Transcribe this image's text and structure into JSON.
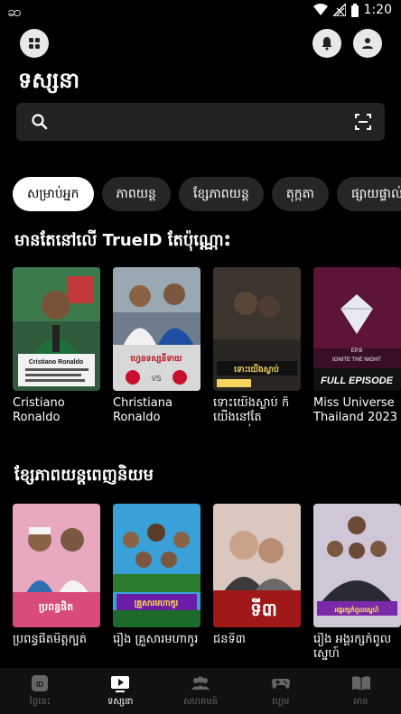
{
  "status": {
    "time": "1:20"
  },
  "header": {
    "title": "ទស្សនា"
  },
  "search": {
    "placeholder": ""
  },
  "chips": [
    "សម្រាប់អ្នក",
    "ភាពយន្ត",
    "ខ្សែភាពយន្ត",
    "តុក្កតា",
    "ផ្សាយផ្ទាល់"
  ],
  "section1": {
    "title": "មានតែនៅលើ TrueID តែប៉ុណ្ណោះ",
    "cards": [
      {
        "title": "Cristiano Ronaldo",
        "thumb_text": "Cristiano Ronaldo"
      },
      {
        "title": "Christiana Ronaldo",
        "thumb_text": "ហ្វេនទស្សនីទាយ"
      },
      {
        "title": "ទោះយើងស្លាប់ ក៏យើងនៅតែស្រឡាញ់",
        "thumb_text": "ទោះយើងស្លាប់"
      },
      {
        "title": "Miss Universe Thailand 2023",
        "thumb_text": "FULL EPISODE",
        "thumb_sub": "IGNITE THE NIGHT",
        "thumb_ep": "EP.8"
      }
    ]
  },
  "section2": {
    "title": "ខ្សែភាពយន្តពេញនិយម",
    "cards": [
      {
        "title": "ប្រពន្ធផិតមិត្តក្បត់",
        "thumb_text": "ប្រពន្ធផិត"
      },
      {
        "title": "រឿង គ្រួសារមហាកូរ",
        "thumb_text": "គ្រួសារមហាកូរ"
      },
      {
        "title": "ជនទី៣",
        "thumb_text": "ទី៣"
      },
      {
        "title": "រឿង អង្គរក្សកំពូលស្នេហ៍",
        "thumb_text": "អង្គរក្សកំពូលស្នេហ៍"
      }
    ]
  },
  "nav": [
    {
      "label": "ថ្ងៃនេះ",
      "icon": "id-icon"
    },
    {
      "label": "ទស្សនា",
      "icon": "play-icon"
    },
    {
      "label": "សហគមន៍",
      "icon": "people-icon"
    },
    {
      "label": "ហ្គេម",
      "icon": "gamepad-icon"
    },
    {
      "label": "អាន",
      "icon": "book-icon"
    }
  ]
}
